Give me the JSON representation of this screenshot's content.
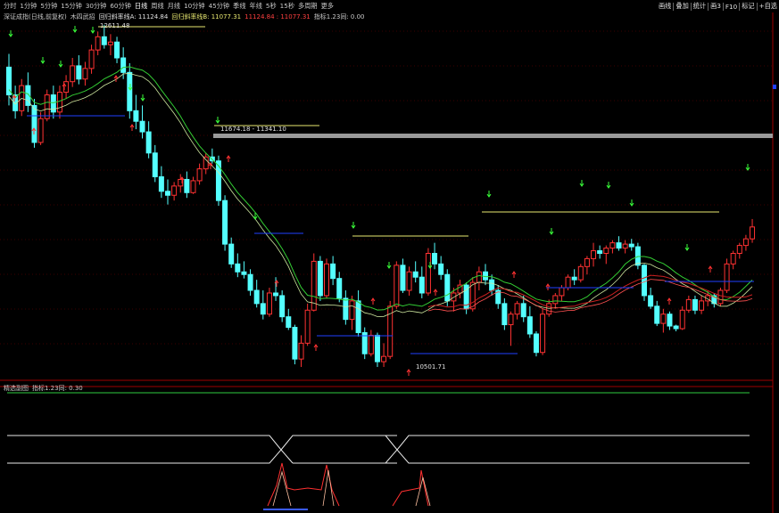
{
  "toolbar": {
    "timeframes": [
      "分时",
      "1分钟",
      "5分钟",
      "15分钟",
      "30分钟",
      "60分钟",
      "日线",
      "周线",
      "月线",
      "10分钟",
      "45分钟",
      "季线",
      "年线",
      "5秒",
      "15秒",
      "多周期",
      "更多"
    ],
    "selected": "日线",
    "right_buttons": [
      "画线",
      "叠加",
      "统计",
      "画3",
      "F10",
      "标记",
      "+自选"
    ]
  },
  "main_info": {
    "title": "深证成指(日线,前复权)",
    "indicator": "木四武招",
    "line_a_label": "回归斜率线A: 11124.84",
    "line_b_label": "回归斜率线B: 11077.31",
    "values": "11124.84 : 11077.31",
    "tail": "指标1.23同: 0.00"
  },
  "sub_info": {
    "title": "精选副图",
    "tail": "指标1.23同: 0.30"
  },
  "annotations": {
    "high_label": "12611.48",
    "mid_label": "11674.18 - 11341.10",
    "low_label": "10501.71"
  },
  "colors": {
    "up": "#ff3232",
    "down": "#54ffff",
    "green_line": "#33cc33",
    "red_line": "#cc2020",
    "yellow_line": "#e8e870",
    "blue_line": "#2040ff",
    "grid": "#7a0000"
  },
  "chart_data": {
    "type": "candlestick",
    "candles": [
      [
        12290,
        12390,
        12000,
        12080
      ],
      [
        12080,
        12150,
        11900,
        11960
      ],
      [
        11960,
        12200,
        11920,
        12150
      ],
      [
        12150,
        12250,
        11950,
        12000
      ],
      [
        12000,
        12050,
        11680,
        11720
      ],
      [
        11720,
        11950,
        11700,
        11900
      ],
      [
        11900,
        12120,
        11880,
        12080
      ],
      [
        12080,
        12150,
        11900,
        11950
      ],
      [
        11950,
        12150,
        11900,
        12100
      ],
      [
        12100,
        12230,
        12050,
        12180
      ],
      [
        12180,
        12360,
        12140,
        12300
      ],
      [
        12300,
        12380,
        12160,
        12200
      ],
      [
        12200,
        12330,
        12150,
        12280
      ],
      [
        12280,
        12460,
        12240,
        12420
      ],
      [
        12420,
        12560,
        12380,
        12520
      ],
      [
        12520,
        12611,
        12430,
        12460
      ],
      [
        12460,
        12540,
        12380,
        12480
      ],
      [
        12480,
        12520,
        12320,
        12360
      ],
      [
        12360,
        12440,
        12200,
        12250
      ],
      [
        12250,
        12320,
        11900,
        11960
      ],
      [
        11960,
        12080,
        11820,
        11880
      ],
      [
        11880,
        12000,
        11750,
        11800
      ],
      [
        11800,
        11880,
        11600,
        11640
      ],
      [
        11640,
        11700,
        11420,
        11460
      ],
      [
        11460,
        11540,
        11300,
        11350
      ],
      [
        11350,
        11440,
        11250,
        11320
      ],
      [
        11320,
        11420,
        11280,
        11390
      ],
      [
        11390,
        11480,
        11340,
        11440
      ],
      [
        11440,
        11500,
        11300,
        11340
      ],
      [
        11340,
        11460,
        11330,
        11430
      ],
      [
        11430,
        11560,
        11400,
        11520
      ],
      [
        11520,
        11640,
        11480,
        11610
      ],
      [
        11610,
        11674,
        11560,
        11580
      ],
      [
        11580,
        11620,
        11240,
        11280
      ],
      [
        11280,
        11320,
        10900,
        10950
      ],
      [
        10950,
        11000,
        10770,
        10800
      ],
      [
        10800,
        10880,
        10700,
        10740
      ],
      [
        10740,
        10820,
        10690,
        10720
      ],
      [
        10720,
        10760,
        10560,
        10600
      ],
      [
        10600,
        10680,
        10470,
        10500
      ],
      [
        10500,
        10600,
        10380,
        10420
      ],
      [
        10420,
        10620,
        10400,
        10580
      ],
      [
        10580,
        10700,
        10520,
        10560
      ],
      [
        10560,
        10600,
        10360,
        10400
      ],
      [
        10400,
        10460,
        10300,
        10320
      ],
      [
        10320,
        10340,
        10040,
        10080
      ],
      [
        10080,
        10260,
        10020,
        10200
      ],
      [
        10200,
        10500,
        10180,
        10450
      ],
      [
        10450,
        10880,
        10440,
        10820
      ],
      [
        10820,
        10860,
        10520,
        10560
      ],
      [
        10560,
        10840,
        10540,
        10800
      ],
      [
        10800,
        10860,
        10640,
        10690
      ],
      [
        10690,
        10740,
        10510,
        10540
      ],
      [
        10540,
        10600,
        10340,
        10380
      ],
      [
        10380,
        10560,
        10300,
        10520
      ],
      [
        10520,
        10600,
        10250,
        10280
      ],
      [
        10280,
        10320,
        10080,
        10120
      ],
      [
        10120,
        10300,
        10100,
        10260
      ],
      [
        10260,
        10280,
        10020,
        10060
      ],
      [
        10060,
        10200,
        10020,
        10100
      ],
      [
        10100,
        10520,
        10080,
        10480
      ],
      [
        10480,
        10820,
        10460,
        10790
      ],
      [
        10790,
        10840,
        10580,
        10600
      ],
      [
        10600,
        10780,
        10560,
        10740
      ],
      [
        10740,
        10820,
        10660,
        10700
      ],
      [
        10700,
        10780,
        10540,
        10580
      ],
      [
        10580,
        10920,
        10560,
        10880
      ],
      [
        10880,
        10960,
        10760,
        10800
      ],
      [
        10800,
        10860,
        10680,
        10720
      ],
      [
        10720,
        10760,
        10480,
        10520
      ],
      [
        10520,
        10620,
        10440,
        10580
      ],
      [
        10580,
        10680,
        10540,
        10640
      ],
      [
        10640,
        10660,
        10420,
        10460
      ],
      [
        10460,
        10700,
        10440,
        10660
      ],
      [
        10660,
        10780,
        10600,
        10740
      ],
      [
        10740,
        10800,
        10640,
        10680
      ],
      [
        10680,
        10720,
        10560,
        10600
      ],
      [
        10600,
        10640,
        10460,
        10500
      ],
      [
        10500,
        10540,
        10300,
        10340
      ],
      [
        10340,
        10440,
        10180,
        10420
      ],
      [
        10420,
        10520,
        10380,
        10500
      ],
      [
        10500,
        10560,
        10360,
        10400
      ],
      [
        10400,
        10480,
        10240,
        10270
      ],
      [
        10270,
        10290,
        10100,
        10130
      ],
      [
        10130,
        10460,
        10110,
        10420
      ],
      [
        10420,
        10530,
        10400,
        10500
      ],
      [
        10500,
        10580,
        10460,
        10560
      ],
      [
        10560,
        10640,
        10520,
        10620
      ],
      [
        10620,
        10720,
        10600,
        10700
      ],
      [
        10700,
        10760,
        10640,
        10680
      ],
      [
        10680,
        10800,
        10660,
        10780
      ],
      [
        10780,
        10860,
        10720,
        10840
      ],
      [
        10840,
        10960,
        10780,
        10900
      ],
      [
        10900,
        10940,
        10840,
        10880
      ],
      [
        10880,
        10940,
        10800,
        10920
      ],
      [
        10920,
        10980,
        10880,
        10960
      ],
      [
        10960,
        11010,
        10900,
        10920
      ],
      [
        10920,
        10980,
        10880,
        10950
      ],
      [
        10950,
        10990,
        10900,
        10930
      ],
      [
        10930,
        10960,
        10760,
        10790
      ],
      [
        10790,
        10800,
        10520,
        10560
      ],
      [
        10560,
        10620,
        10460,
        10480
      ],
      [
        10480,
        10520,
        10330,
        10350
      ],
      [
        10350,
        10460,
        10280,
        10420
      ],
      [
        10420,
        10440,
        10300,
        10330
      ],
      [
        10330,
        10340,
        10290,
        10310
      ],
      [
        10310,
        10480,
        10300,
        10450
      ],
      [
        10450,
        10560,
        10430,
        10530
      ],
      [
        10530,
        10560,
        10420,
        10450
      ],
      [
        10450,
        10560,
        10420,
        10520
      ],
      [
        10520,
        10600,
        10480,
        10560
      ],
      [
        10560,
        10580,
        10470,
        10500
      ],
      [
        10500,
        10620,
        10480,
        10600
      ],
      [
        10600,
        10840,
        10580,
        10800
      ],
      [
        10800,
        10900,
        10760,
        10880
      ],
      [
        10880,
        10960,
        10840,
        10940
      ],
      [
        10940,
        11020,
        10900,
        10990
      ],
      [
        10990,
        11140,
        10960,
        11080
      ]
    ],
    "ylim": [
      10000,
      12650
    ]
  }
}
